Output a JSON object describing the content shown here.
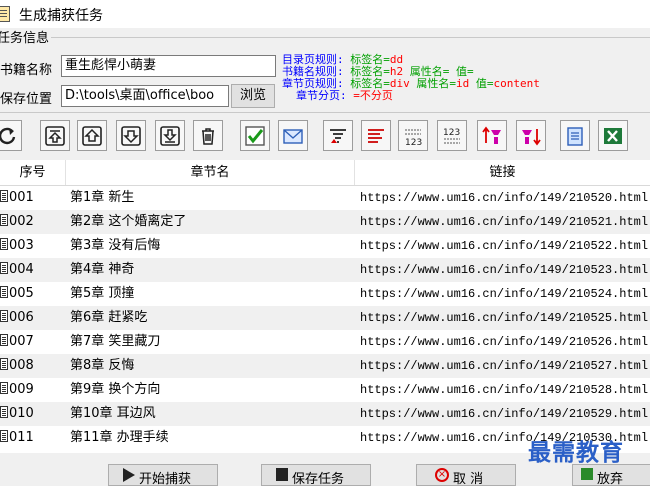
{
  "window": {
    "title": "生成捕获任务"
  },
  "task_info": {
    "legend": "任务信息",
    "book_name_label": "书籍名称",
    "book_name_value": "重生彪悍小萌妻",
    "save_location_label": "保存位置",
    "save_location_value": "D:\\tools\\桌面\\office\\boo",
    "browse_label": "浏览"
  },
  "rules": {
    "catalog": {
      "key": "目录页规则:",
      "tag_label": "标签名=",
      "tag_value": "dd"
    },
    "bookname": {
      "key": "书籍名规则:",
      "tag_label": "标签名=",
      "tag_value": "h2",
      "attr_label": "属性名=",
      "value_label": "值="
    },
    "chapter": {
      "key": "章节页规则:",
      "tag_label": "标签名=",
      "tag_value": "div",
      "attr_label": "属性名=",
      "attr_value": "id",
      "value_label": "值=",
      "value_value": "content"
    },
    "paging": {
      "key": "章节分页:",
      "value": "=不分页"
    }
  },
  "table": {
    "headers": [
      "序号",
      "章节名",
      "链接"
    ],
    "rows": [
      {
        "no": "001",
        "chapter": "第1章  新生",
        "link": "https://www.um16.cn/info/149/210520.html"
      },
      {
        "no": "002",
        "chapter": "第2章  这个婚离定了",
        "link": "https://www.um16.cn/info/149/210521.html"
      },
      {
        "no": "003",
        "chapter": "第3章  没有后悔",
        "link": "https://www.um16.cn/info/149/210522.html"
      },
      {
        "no": "004",
        "chapter": "第4章  神奇",
        "link": "https://www.um16.cn/info/149/210523.html"
      },
      {
        "no": "005",
        "chapter": "第5章  顶撞",
        "link": "https://www.um16.cn/info/149/210524.html"
      },
      {
        "no": "006",
        "chapter": "第6章  赶紧吃",
        "link": "https://www.um16.cn/info/149/210525.html"
      },
      {
        "no": "007",
        "chapter": "第7章  笑里藏刀",
        "link": "https://www.um16.cn/info/149/210526.html"
      },
      {
        "no": "008",
        "chapter": "第8章  反悔",
        "link": "https://www.um16.cn/info/149/210527.html"
      },
      {
        "no": "009",
        "chapter": "第9章  换个方向",
        "link": "https://www.um16.cn/info/149/210528.html"
      },
      {
        "no": "010",
        "chapter": "第10章  耳边风",
        "link": "https://www.um16.cn/info/149/210529.html"
      },
      {
        "no": "011",
        "chapter": "第11章  办理手续",
        "link": "https://www.um16.cn/info/149/210530.html"
      }
    ]
  },
  "buttons": {
    "start": "开始捕获",
    "save_task": "保存任务",
    "cancel": "取  消",
    "abandon": "放弃"
  },
  "watermark": "最需教育"
}
